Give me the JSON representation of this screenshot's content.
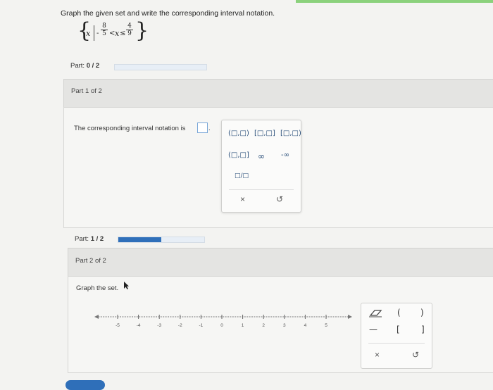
{
  "prompt": "Graph the given set and write the corresponding interval notation.",
  "set": {
    "variable": "x",
    "left_num": "8",
    "left_den": "5",
    "left_sign": "-",
    "left_op": "<",
    "mid_var": "x",
    "right_op": "≤",
    "right_num": "4",
    "right_den": "9"
  },
  "part_top": {
    "label": "Part:",
    "value": "0 / 2",
    "progress": 0.0
  },
  "part1": {
    "header": "Part 1 of 2",
    "answer_text": "The corresponding interval notation is",
    "answer_suffix": "."
  },
  "palette": {
    "row1": [
      "(□,□)",
      "[□,□]",
      "[□,□)"
    ],
    "row2": [
      "(□,□]",
      "∞",
      "-∞"
    ],
    "frac": "□/□",
    "clear": "×",
    "undo": "↺"
  },
  "part_mid": {
    "label": "Part:",
    "value": "1 / 2",
    "progress": 0.5
  },
  "part2": {
    "header": "Part 2 of 2",
    "instruction": "Graph the set."
  },
  "numberline": {
    "ticks": [
      "-5",
      "-4",
      "-3",
      "-2",
      "-1",
      "0",
      "1",
      "2",
      "3",
      "4",
      "5"
    ]
  },
  "graph_tools": {
    "eraser": "eraser-tool",
    "open_paren": "(",
    "close_paren": ")",
    "segment": "—",
    "open_bracket": "[",
    "close_bracket": "]",
    "clear": "×",
    "undo": "↺"
  }
}
